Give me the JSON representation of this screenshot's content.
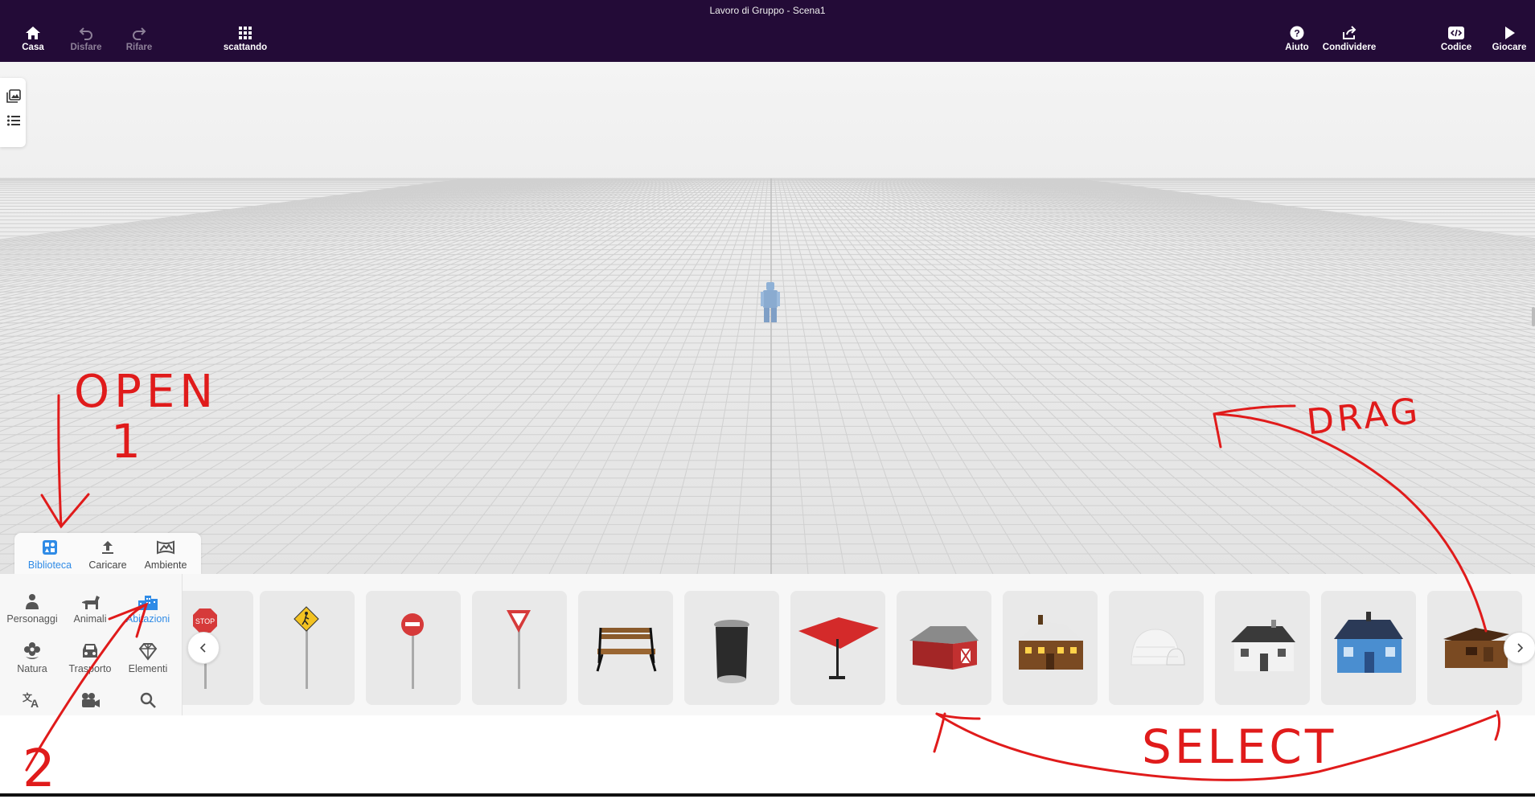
{
  "window": {
    "title": "Lavoro di Gruppo - Scena1"
  },
  "toolbar": {
    "home": "Casa",
    "undo": "Disfare",
    "redo": "Rifare",
    "gallery": "scattando",
    "help": "Aiuto",
    "share": "Condividere",
    "code": "Codice",
    "play": "Giocare"
  },
  "library_tabs": [
    {
      "label": "Biblioteca",
      "active": true,
      "icon": "library-icon"
    },
    {
      "label": "Caricare",
      "active": false,
      "icon": "upload-icon"
    },
    {
      "label": "Ambiente",
      "active": false,
      "icon": "landscape-icon"
    }
  ],
  "categories": [
    {
      "label": "Personaggi",
      "icon": "person-icon",
      "active": false
    },
    {
      "label": "Animali",
      "icon": "dog-icon",
      "active": false
    },
    {
      "label": "Abitazioni",
      "icon": "buildings-icon",
      "active": true
    },
    {
      "label": "Natura",
      "icon": "flower-icon",
      "active": false
    },
    {
      "label": "Trasporto",
      "icon": "car-icon",
      "active": false
    },
    {
      "label": "Elementi",
      "icon": "gem-icon",
      "active": false
    },
    {
      "label": "",
      "icon": "translate-icon",
      "active": false
    },
    {
      "label": "",
      "icon": "video-camera-icon",
      "active": false
    },
    {
      "label": "",
      "icon": "search-icon",
      "active": false
    }
  ],
  "models": [
    {
      "name": "stop-sign",
      "text": "STOP"
    },
    {
      "name": "pedestrian-crossing-sign"
    },
    {
      "name": "no-entry-sign"
    },
    {
      "name": "yield-sign"
    },
    {
      "name": "park-bench"
    },
    {
      "name": "trash-can"
    },
    {
      "name": "red-umbrella"
    },
    {
      "name": "red-barn"
    },
    {
      "name": "snowy-cabin"
    },
    {
      "name": "igloo"
    },
    {
      "name": "white-house"
    },
    {
      "name": "blue-house"
    },
    {
      "name": "wooden-hut"
    }
  ],
  "annotations": {
    "open": "OPEN",
    "step1": "1",
    "step2": "2",
    "drag": "DRAG",
    "select": "SELECT",
    "color": "#e01b1b"
  },
  "colors": {
    "topbar": "#230b37",
    "accent": "#2f8be6"
  }
}
